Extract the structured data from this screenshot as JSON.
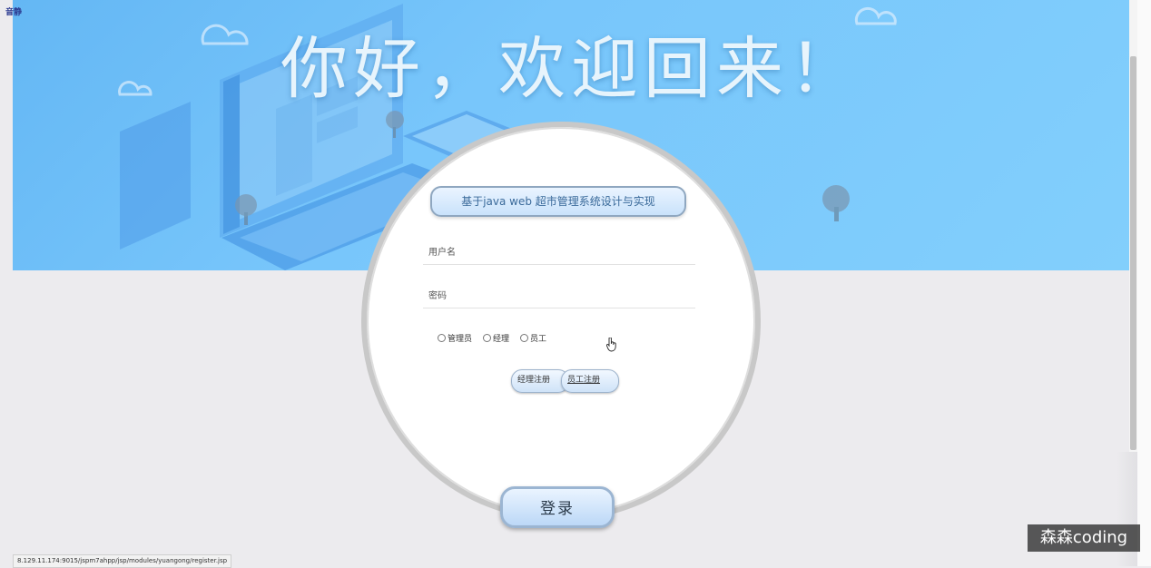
{
  "corner_tag": "音静",
  "header": {
    "title": "你好，欢迎回来！"
  },
  "form": {
    "system_name": "基于java web 超市管理系统设计与实现",
    "username_placeholder": "用户名",
    "password_placeholder": "密码",
    "roles": [
      {
        "label": "管理员",
        "checked": false
      },
      {
        "label": "经理",
        "checked": false
      },
      {
        "label": "员工",
        "checked": false
      }
    ],
    "manager_register_label": "经理注册",
    "employee_register_label": "员工注册",
    "login_label": "登录"
  },
  "status_bar": {
    "url": "8.129.11.174:9015/jspm7ahpp/jsp/modules/yuangong/register.jsp"
  },
  "watermark": "森森coding",
  "colors": {
    "banner": "#78c6fb",
    "background": "#ecebee",
    "button": "#cfe3f8"
  }
}
